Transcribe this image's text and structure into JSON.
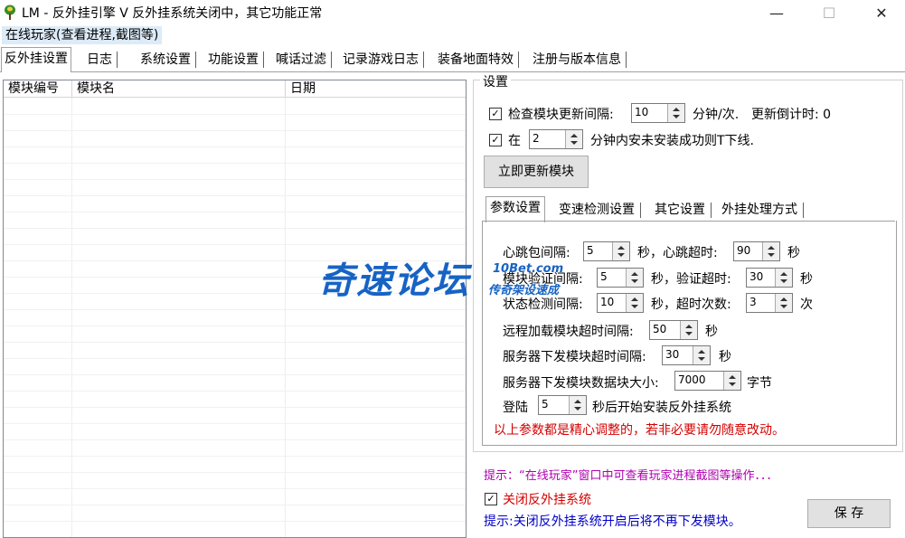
{
  "window": {
    "title": "LM - 反外挂引擎 V 反外挂系统关闭中，其它功能正常",
    "minimize": "—",
    "maximize": "☐",
    "close": "✕"
  },
  "menu": {
    "online_players": "在线玩家(查看进程,截图等)"
  },
  "main_tabs": [
    {
      "label": "反外挂设置",
      "active": true
    },
    {
      "label": "日志"
    },
    {
      "label": "系统设置"
    },
    {
      "label": "功能设置"
    },
    {
      "label": "喊话过滤"
    },
    {
      "label": "记录游戏日志"
    },
    {
      "label": "装备地面特效"
    },
    {
      "label": "注册与版本信息"
    }
  ],
  "module_table": {
    "columns": [
      "模块编号",
      "模块名",
      "日期"
    ],
    "rows": []
  },
  "settings": {
    "legend": "设置",
    "check_update": {
      "checked": true,
      "label": "检查模块更新间隔:",
      "value": "10",
      "unit": "分钟/次.",
      "countdown_label": "更新倒计时: 0"
    },
    "kick": {
      "checked": true,
      "prefix": "在",
      "value": "2",
      "suffix": "分钟内安未安装成功则T下线."
    },
    "update_now_button": "立即更新模块",
    "sub_tabs": [
      {
        "label": "参数设置",
        "active": true
      },
      {
        "label": "变速检测设置"
      },
      {
        "label": "其它设置"
      },
      {
        "label": "外挂处理方式"
      }
    ],
    "params": {
      "heartbeat": {
        "label": "心跳包间隔:",
        "value": "5",
        "unit": "秒，心跳超时:",
        "timeout": "90",
        "timeout_unit": "秒"
      },
      "verify": {
        "label": "模块验证间隔:",
        "value": "5",
        "unit": "秒，验证超时:",
        "timeout": "30",
        "timeout_unit": "秒"
      },
      "status": {
        "label": "状态检测间隔:",
        "value": "10",
        "unit": "秒，超时次数:",
        "timeout": "3",
        "timeout_unit": "次"
      },
      "remote_load": {
        "label": "远程加载模块超时间隔:",
        "value": "50",
        "unit": "秒"
      },
      "server_send": {
        "label": "服务器下发模块超时间隔:",
        "value": "30",
        "unit": "秒"
      },
      "block_size": {
        "label": "服务器下发模块数据块大小:",
        "value": "7000",
        "unit": "字节"
      },
      "login": {
        "label": "登陆",
        "value": "5",
        "unit": "秒后开始安装反外挂系统"
      },
      "warning": "以上参数都是精心调整的，若非必要请勿随意改动。"
    },
    "hint_online": "提示：“在线玩家”窗口中可查看玩家进程截图等操作．．．",
    "close_anticheat": {
      "checked": true,
      "label": "关闭反外挂系统"
    },
    "hint_close": "提示:关闭反外挂系统开启后将不再下发模块。",
    "save_button": "保  存"
  },
  "watermark": {
    "main": "奇速论坛",
    "url": "10Bet.com",
    "sub": "传奇架设速成"
  },
  "colors": {
    "red_text": "#d40000",
    "purple_text": "#b000b0",
    "blue_text": "#0000c8",
    "watermark": "#1763c4"
  }
}
